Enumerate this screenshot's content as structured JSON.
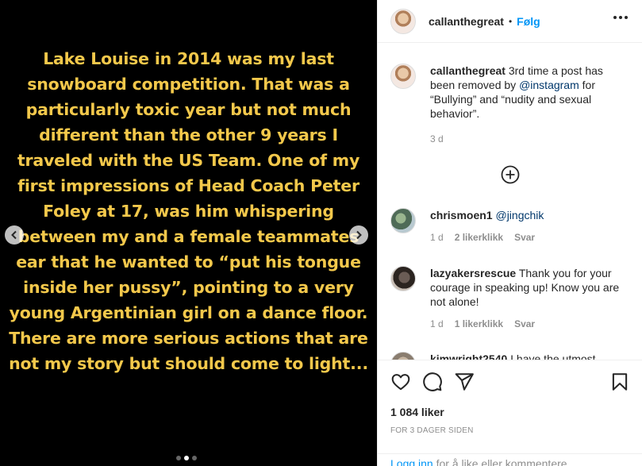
{
  "media": {
    "text": "Lake Louise in 2014 was my last snowboard competition. That was a particularly toxic year but not much different than the other 9 years I traveled with the US Team. One of my first impressions of Head Coach Peter Foley at 17, was him whispering between my and a female teammates ear that he wanted to “put his tongue inside her pussy”, pointing to a very young Argentinian girl on a dance floor. There are more serious actions that are not my story but should come to light...",
    "text_color": "#f3c84b",
    "carousel": {
      "count": 3,
      "active_index": 1
    }
  },
  "header": {
    "username": "callanthegreat",
    "separator": "•",
    "follow_label": "Følg"
  },
  "caption": {
    "username": "callanthegreat",
    "text_before": " 3rd time a post has been removed by ",
    "mention": "@instagram",
    "text_after": " for “Bullying” and “nudity and sexual behavior”.",
    "time": "3 d"
  },
  "comments": [
    {
      "username": "chrismoen1",
      "mention": "@jingchik",
      "text": "",
      "time": "1 d",
      "likes": "2 likerklikk",
      "reply": "Svar"
    },
    {
      "username": "lazyakersrescue",
      "mention": "",
      "text": " Thank you for your courage in speaking up! Know you are not alone!",
      "time": "1 d",
      "likes": "1 likerklikk",
      "reply": "Svar"
    },
    {
      "username": "kimwright2540",
      "mention": "",
      "text": " I have the utmost",
      "time": "",
      "likes": "",
      "reply": ""
    }
  ],
  "footer": {
    "likes": "1 084 liker",
    "time_ago": "FOR 3 DAGER SIDEN",
    "login_label": "Logg inn",
    "login_suffix": " for å like eller kommentere."
  },
  "colors": {
    "accent": "#0095f6",
    "mention": "#00376b",
    "muted": "#8e8e8e"
  }
}
